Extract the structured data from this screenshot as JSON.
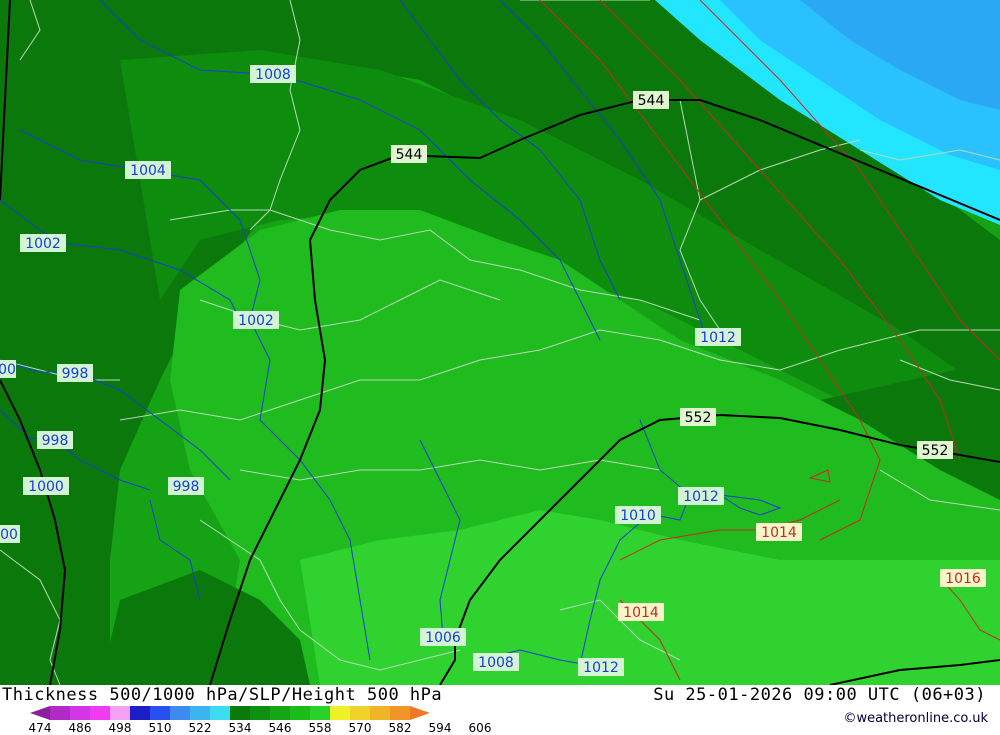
{
  "map": {
    "isobar_labels": [
      "1008",
      "1004",
      "1002",
      "1002",
      "998",
      "998",
      "998",
      "1000",
      "1012",
      "1012",
      "1010",
      "1014",
      "1014",
      "1016",
      "1006",
      "1008",
      "1012",
      "00",
      "00"
    ],
    "height_labels": [
      "544",
      "544",
      "552",
      "552"
    ],
    "colors": {
      "bg_green": "#16a316",
      "dark_green": "#0a7a0a",
      "mid_green": "#10900f",
      "light_green": "#1fbc1f",
      "bright_green": "#2fd22f",
      "cyan": "#22e6ff",
      "sky": "#29c2ff",
      "isobar_blue": "#1c3cd8",
      "isobar_red": "#c82828",
      "height_black": "#000000",
      "border_gray": "#b8d8b8"
    }
  },
  "footer": {
    "title": "Thickness 500/1000 hPa/SLP/Height 500 hPa",
    "datetime": "Su 25-01-2026 09:00 UTC (06+03)",
    "credit": "©weatheronline.co.uk",
    "scale_ticks": [
      "474",
      "486",
      "498",
      "510",
      "522",
      "534",
      "546",
      "558",
      "570",
      "582",
      "594",
      "606"
    ],
    "scale_colors": [
      "#8a1e9c",
      "#b02ac8",
      "#d236e6",
      "#f03cf0",
      "#f4a0f4",
      "#1e1ec8",
      "#2850f0",
      "#3c8cf0",
      "#3cb4f0",
      "#3cdcf0",
      "#0a7a0a",
      "#0f8f0f",
      "#15a515",
      "#1cbb1c",
      "#28d228",
      "#f0f028",
      "#f0d228",
      "#f0b428",
      "#f09628",
      "#f07828"
    ]
  }
}
